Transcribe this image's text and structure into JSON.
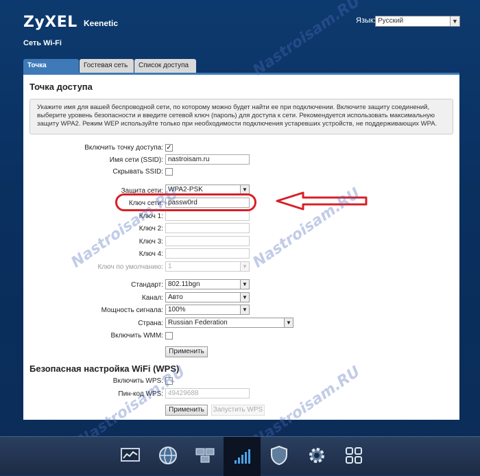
{
  "header": {
    "brand": "ZyXEL",
    "model": "Keenetic",
    "page_title": "Сеть Wi-Fi",
    "lang_label": "Язык:",
    "lang_value": "Русский"
  },
  "tabs": [
    {
      "label": "Точка доступа",
      "active": true
    },
    {
      "label": "Гостевая сеть",
      "active": false
    },
    {
      "label": "Список доступа",
      "active": false
    }
  ],
  "ap_section": {
    "title": "Точка доступа",
    "info": "Укажите имя для вашей беспроводной сети, по которому можно будет найти ее при подключении. Включите защиту соединений, выберите уровень безопасности и введите сетевой ключ (пароль) для доступа к сети. Рекомендуется использовать максимальную защиту WPA2. Режим WEP используйте только при необходимости подключения устаревших устройств, не поддерживающих WPA.",
    "enable_label": "Включить точку доступа:",
    "ssid_label": "Имя сети (SSID):",
    "ssid_value": "nastroisam.ru",
    "hide_ssid_label": "Скрывать SSID:",
    "security_label": "Защита сети:",
    "security_value": "WPA2-PSK",
    "key_label": "Ключ сети:",
    "key_value": "passw0rd",
    "key1_label": "Ключ 1:",
    "key2_label": "Ключ 2:",
    "key3_label": "Ключ 3:",
    "key4_label": "Ключ 4:",
    "default_key_label": "Ключ по умолчанию:",
    "default_key_value": "1",
    "standard_label": "Стандарт:",
    "standard_value": "802.11bgn",
    "channel_label": "Канал:",
    "channel_value": "Авто",
    "power_label": "Мощность сигнала:",
    "power_value": "100%",
    "country_label": "Страна:",
    "country_value": "Russian Federation",
    "wmm_label": "Включить WMM:",
    "apply_label": "Применить"
  },
  "wps_section": {
    "title": "Безопасная настройка WiFi (WPS)",
    "enable_label": "Включить WPS:",
    "pin_label": "Пин-код WPS:",
    "pin_value": "49429688",
    "apply_label": "Применить",
    "start_label": "Запустить WPS"
  },
  "watermark_text": "Nastroisam.RU",
  "colors": {
    "accent": "#3f7ab8",
    "highlight": "#d81f26"
  }
}
